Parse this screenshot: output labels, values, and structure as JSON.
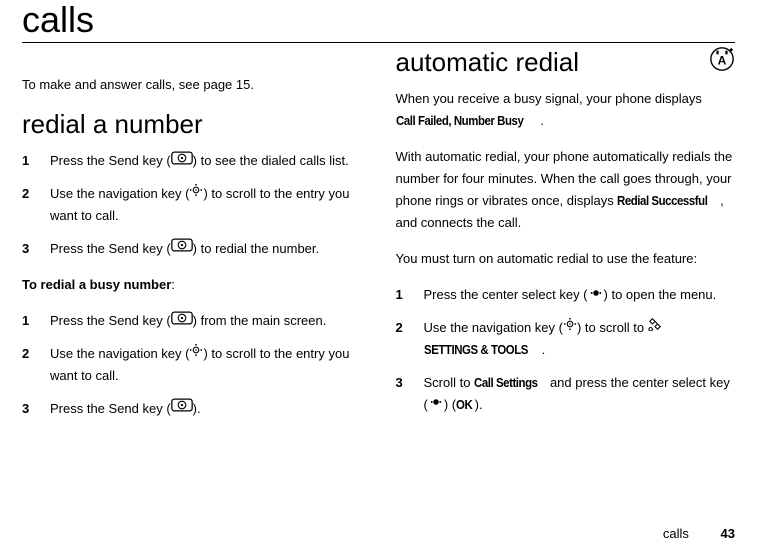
{
  "chapter": {
    "title": "calls"
  },
  "intro": "To make and answer calls, see page 15.",
  "left": {
    "heading": "redial a number",
    "stepsA": [
      {
        "pre": "Press the Send key (",
        "post": ") to see the dialed calls list."
      },
      {
        "pre": "Use the navigation key (",
        "post": ") to scroll to the entry you want to call."
      },
      {
        "pre": "Press the Send key (",
        "post": ") to redial the number."
      }
    ],
    "busyLabel": "To redial a busy number",
    "stepsB": [
      {
        "pre": "Press the Send key (",
        "post": ") from the main screen."
      },
      {
        "pre": "Use the navigation key (",
        "post": ") to scroll to the entry you want to call."
      },
      {
        "pre": "Press the Send key (",
        "post": ")."
      }
    ]
  },
  "right": {
    "heading": "automatic redial",
    "p1a": "When you receive a busy signal, your phone displays ",
    "p1cond": "Call Failed, Number Busy",
    "p1b": ".",
    "p2a": "With automatic redial, your phone automatically redials the number for four minutes. When the call goes through, your phone rings or vibrates once, displays ",
    "p2cond": "Redial Successful",
    "p2b": ", and connects the call.",
    "p3": "You must turn on automatic redial to use the feature:",
    "steps": [
      {
        "pre": "Press the center select key (",
        "post": ") to open the menu."
      },
      {
        "pre": "Use the navigation key (",
        "post": ") to scroll to ",
        "tail_cond": "SETTINGS & TOOLS",
        "tail_post": "."
      },
      {
        "pre": "Scroll to ",
        "mid_cond": "Call Settings",
        "mid": " and press the center select key (",
        "post": ") (",
        "tail_cond": "OK",
        "tail_post": ")."
      }
    ]
  },
  "footer": {
    "label": "calls",
    "page": "43"
  },
  "nums": [
    "1",
    "2",
    "3"
  ]
}
